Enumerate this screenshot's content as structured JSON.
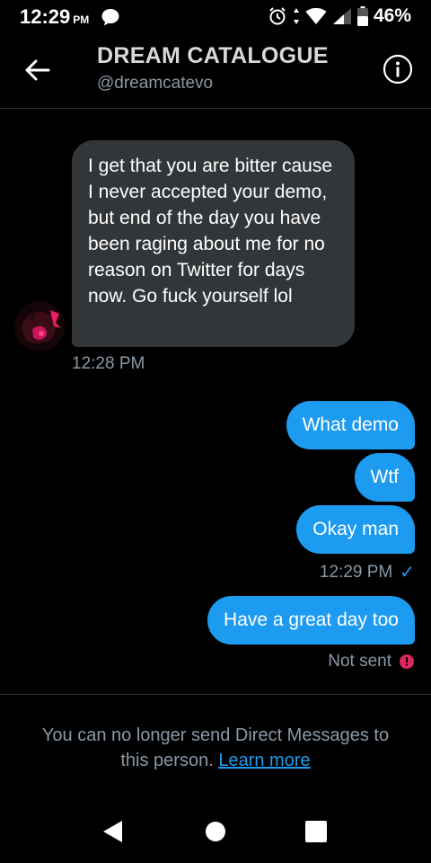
{
  "status_bar": {
    "time": "12:29",
    "ampm": "PM",
    "battery": "46%"
  },
  "header": {
    "title": "DREAM CATALOGUE",
    "handle": "@dreamcatevo"
  },
  "messages": [
    {
      "direction": "incoming",
      "text": "I get that you are bitter cause I never accepted your demo, but end of the day you have been raging about me for no reason on Twitter for days now. Go fuck yourself lol",
      "time": "12:28 PM"
    },
    {
      "direction": "outgoing",
      "text": "What demo"
    },
    {
      "direction": "outgoing",
      "text": "Wtf"
    },
    {
      "direction": "outgoing",
      "text": "Okay man",
      "time": "12:29 PM",
      "status": "read"
    },
    {
      "direction": "outgoing",
      "text": "Have a great day too",
      "status_text": "Not sent"
    }
  ],
  "notice": {
    "text": "You can no longer send Direct Messages to this person.",
    "link": "Learn more"
  },
  "icons": {
    "back": "arrow-left-icon",
    "info": "info-icon",
    "message": "message-bubble-icon",
    "alarm": "alarm-icon",
    "wifi": "wifi-icon",
    "signal": "signal-icon",
    "battery": "battery-icon",
    "check": "checkmark-icon",
    "error": "error-icon",
    "nav_back": "triangle-back-icon",
    "nav_home": "circle-home-icon",
    "nav_recents": "square-recents-icon"
  },
  "colors": {
    "accent": "#1d9bf0",
    "incoming_bubble": "#323639",
    "muted": "#8b98a5",
    "error": "#e0245e"
  }
}
